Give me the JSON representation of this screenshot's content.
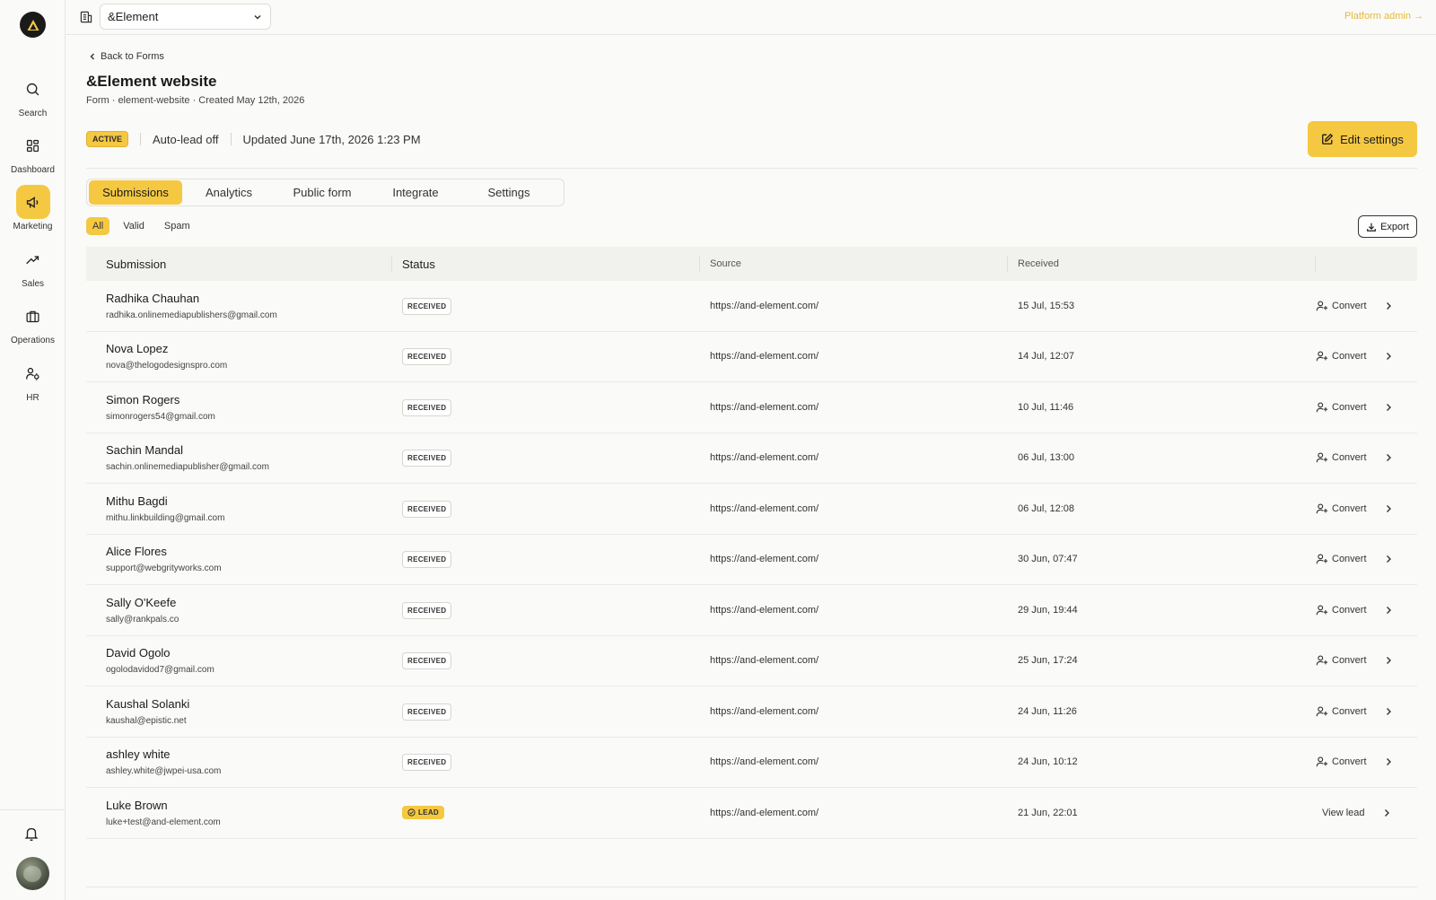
{
  "sidebar": {
    "items": [
      {
        "label": "Search",
        "icon": "search-icon"
      },
      {
        "label": "Dashboard",
        "icon": "dashboard-icon"
      },
      {
        "label": "Marketing",
        "icon": "megaphone-icon"
      },
      {
        "label": "Sales",
        "icon": "trend-icon"
      },
      {
        "label": "Operations",
        "icon": "briefcase-icon"
      },
      {
        "label": "HR",
        "icon": "people-icon"
      }
    ],
    "active": "Marketing"
  },
  "topbar": {
    "org": "&Element",
    "platform_admin": "Platform admin →"
  },
  "header": {
    "back_label": "Back to Forms",
    "title": "&Element website",
    "subtitle": "Form · element-website · Created May 12th, 2026",
    "status": "ACTIVE",
    "auto_lead": "Auto-lead off",
    "updated": "Updated June 17th, 2026 1:23 PM",
    "edit_label": "Edit settings"
  },
  "tabs": [
    "Submissions",
    "Analytics",
    "Public form",
    "Integrate",
    "Settings"
  ],
  "filters": [
    "All",
    "Valid",
    "Spam"
  ],
  "export_label": "Export",
  "table": {
    "headers": {
      "submission": "Submission",
      "status": "Status",
      "source": "Source",
      "received": "Received"
    },
    "rows": [
      {
        "name": "Radhika Chauhan",
        "email": "radhika.onlinemediapublishers@gmail.com",
        "status": "RECEIVED",
        "source": "https://and-element.com/",
        "received": "15 Jul, 15:53",
        "action": "Convert"
      },
      {
        "name": "Nova Lopez",
        "email": "nova@thelogodesignspro.com",
        "status": "RECEIVED",
        "source": "https://and-element.com/",
        "received": "14 Jul, 12:07",
        "action": "Convert"
      },
      {
        "name": "Simon Rogers",
        "email": "simonrogers54@gmail.com",
        "status": "RECEIVED",
        "source": "https://and-element.com/",
        "received": "10 Jul, 11:46",
        "action": "Convert"
      },
      {
        "name": "Sachin Mandal",
        "email": "sachin.onlinemediapublisher@gmail.com",
        "status": "RECEIVED",
        "source": "https://and-element.com/",
        "received": "06 Jul, 13:00",
        "action": "Convert"
      },
      {
        "name": "Mithu Bagdi",
        "email": "mithu.linkbuilding@gmail.com",
        "status": "RECEIVED",
        "source": "https://and-element.com/",
        "received": "06 Jul, 12:08",
        "action": "Convert"
      },
      {
        "name": "Alice Flores",
        "email": "support@webgrityworks.com",
        "status": "RECEIVED",
        "source": "https://and-element.com/",
        "received": "30 Jun, 07:47",
        "action": "Convert"
      },
      {
        "name": "Sally O'Keefe",
        "email": "sally@rankpals.co",
        "status": "RECEIVED",
        "source": "https://and-element.com/",
        "received": "29 Jun, 19:44",
        "action": "Convert"
      },
      {
        "name": "David Ogolo",
        "email": "ogolodavidod7@gmail.com",
        "status": "RECEIVED",
        "source": "https://and-element.com/",
        "received": "25 Jun, 17:24",
        "action": "Convert"
      },
      {
        "name": "Kaushal Solanki",
        "email": "kaushal@epistic.net",
        "status": "RECEIVED",
        "source": "https://and-element.com/",
        "received": "24 Jun, 11:26",
        "action": "Convert"
      },
      {
        "name": "ashley white",
        "email": "ashley.white@jwpei-usa.com",
        "status": "RECEIVED",
        "source": "https://and-element.com/",
        "received": "24 Jun, 10:12",
        "action": "Convert"
      },
      {
        "name": "Luke Brown",
        "email": "luke+test@and-element.com",
        "status": "LEAD",
        "source": "https://and-element.com/",
        "received": "21 Jun, 22:01",
        "action": "View lead"
      }
    ]
  },
  "colors": {
    "accent": "#f5c842",
    "platform_admin": "#e5b93a"
  }
}
